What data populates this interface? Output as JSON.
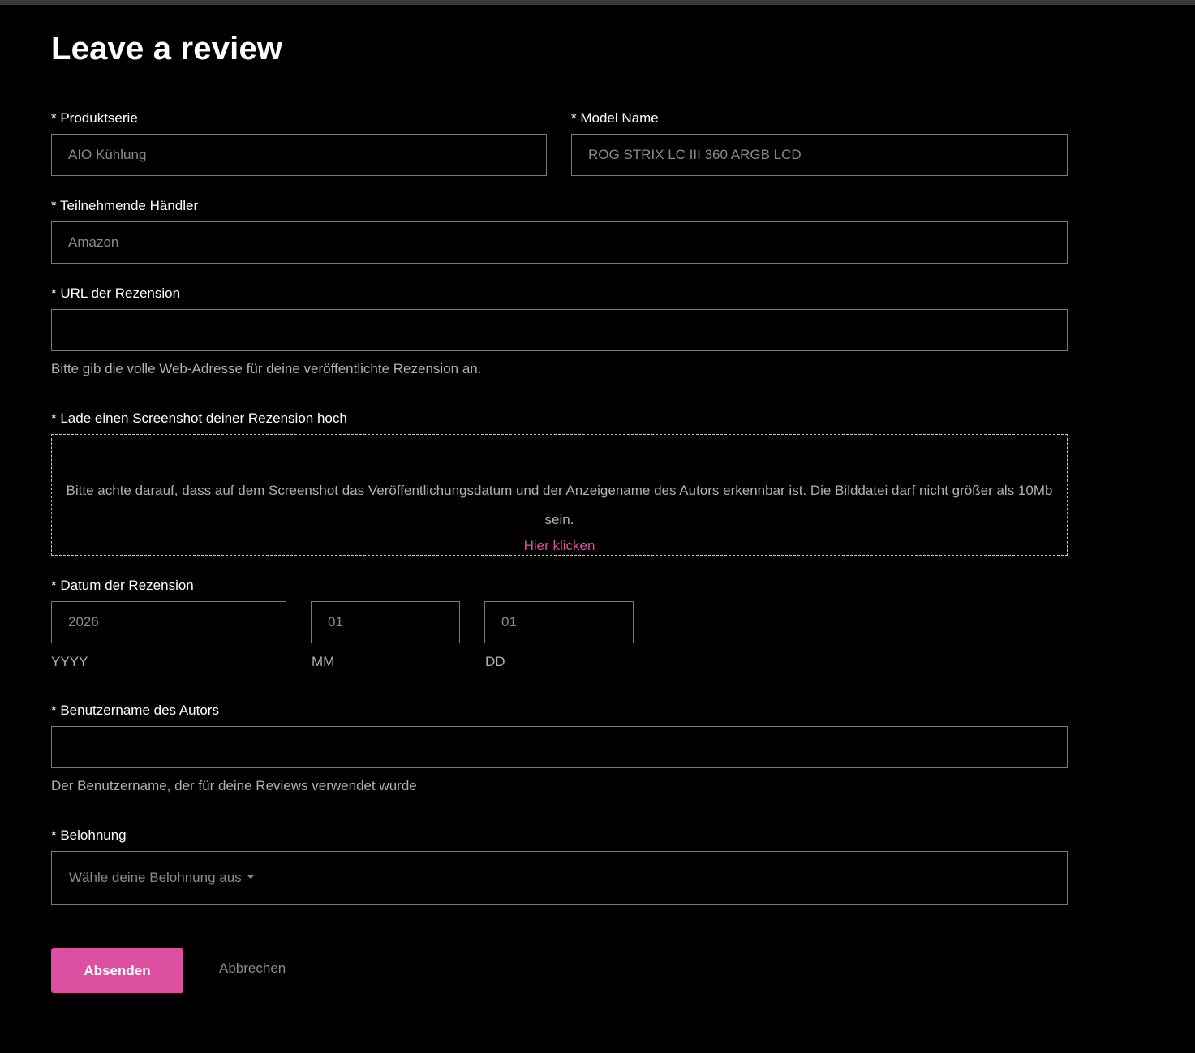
{
  "page": {
    "title": "Leave a review"
  },
  "form": {
    "product_series": {
      "label": "* Produktserie",
      "value": "AIO Kühlung"
    },
    "model_name": {
      "label": "* Model Name",
      "value": "ROG STRIX LC III 360 ARGB LCD"
    },
    "retailer": {
      "label": "* Teilnehmende Händler",
      "value": "Amazon"
    },
    "review_url": {
      "label": "* URL der Rezension",
      "value": "",
      "help": "Bitte gib die volle Web-Adresse für deine veröffentlichte Rezension an."
    },
    "screenshot": {
      "label": "* Lade einen Screenshot deiner Rezension hoch",
      "instructions": "Bitte achte darauf, dass auf dem Screenshot das Veröffentlichungsdatum und der Anzeigename des Autors erkennbar ist. Die Bilddatei darf nicht größer als 10Mb sein.",
      "link_label": "Hier klicken"
    },
    "review_date": {
      "label": "* Datum der Rezension",
      "year": {
        "placeholder": "2026",
        "caption": "YYYY"
      },
      "month": {
        "placeholder": "01",
        "caption": "MM"
      },
      "day": {
        "placeholder": "01",
        "caption": "DD"
      }
    },
    "author_username": {
      "label": "* Benutzername des Autors",
      "value": "",
      "help": "Der Benutzername, der für deine Reviews verwendet wurde"
    },
    "reward": {
      "label": "* Belohnung",
      "selected": "Wähle deine Belohnung aus"
    }
  },
  "actions": {
    "submit_label": "Absenden",
    "cancel_label": "Abbrechen"
  },
  "colors": {
    "background": "#000000",
    "accent": "#dd4fa0",
    "link": "#e0509f",
    "input_border": "#7a7a7a"
  }
}
